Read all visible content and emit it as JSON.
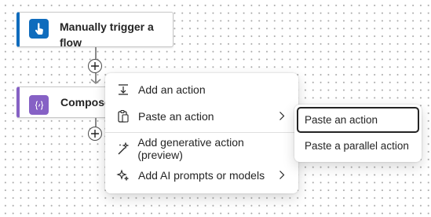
{
  "canvas": {
    "background": "#ffffff",
    "dot_color": "#a9a9a9"
  },
  "flow": {
    "trigger": {
      "title": "Manually trigger a flow",
      "icon": "hand-pointer-icon",
      "accent": "#0f6cbd"
    },
    "compose": {
      "title": "Compose",
      "icon": "compose-braces-icon",
      "accent": "#8661c5"
    },
    "insert_buttons": [
      "add-step-top",
      "add-step-bottom"
    ]
  },
  "context_menu": {
    "items": [
      {
        "label": "Add an action",
        "icon": "add-action-icon",
        "has_submenu": false
      },
      {
        "label": "Paste an action",
        "icon": "paste-icon",
        "has_submenu": true
      },
      {
        "label": "Add generative action (preview)",
        "icon": "sparkle-wand-icon",
        "has_submenu": false
      },
      {
        "label": "Add AI prompts or models",
        "icon": "sparkle-icon",
        "has_submenu": true
      }
    ]
  },
  "submenu": {
    "items": [
      {
        "label": "Paste an action",
        "focused": true
      },
      {
        "label": "Paste a parallel action",
        "focused": false
      }
    ]
  }
}
